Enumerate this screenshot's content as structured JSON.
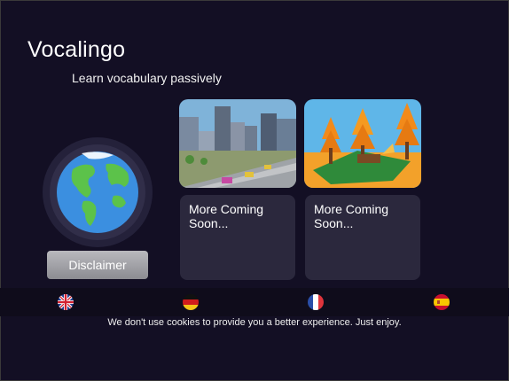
{
  "app": {
    "title": "Vocalingo",
    "subtitle": "Learn vocabulary passively"
  },
  "globe": {
    "icon": "globe-icon"
  },
  "disclaimer": {
    "label": "Disclaimer"
  },
  "scenes": [
    {
      "name": "city-scene-thumbnail"
    },
    {
      "name": "autumn-forest-scene-thumbnail"
    }
  ],
  "coming_soon": [
    {
      "label": "More Coming Soon..."
    },
    {
      "label": "More Coming Soon..."
    }
  ],
  "languages": [
    {
      "name": "uk-flag-icon"
    },
    {
      "name": "germany-flag-icon"
    },
    {
      "name": "france-flag-icon"
    },
    {
      "name": "spain-flag-icon"
    }
  ],
  "footer": {
    "cookie_text": "We don't use cookies to provide you a better experience. Just enjoy."
  },
  "colors": {
    "background": "#130f24",
    "card": "#2b283d",
    "button": "#a9a9ae"
  }
}
